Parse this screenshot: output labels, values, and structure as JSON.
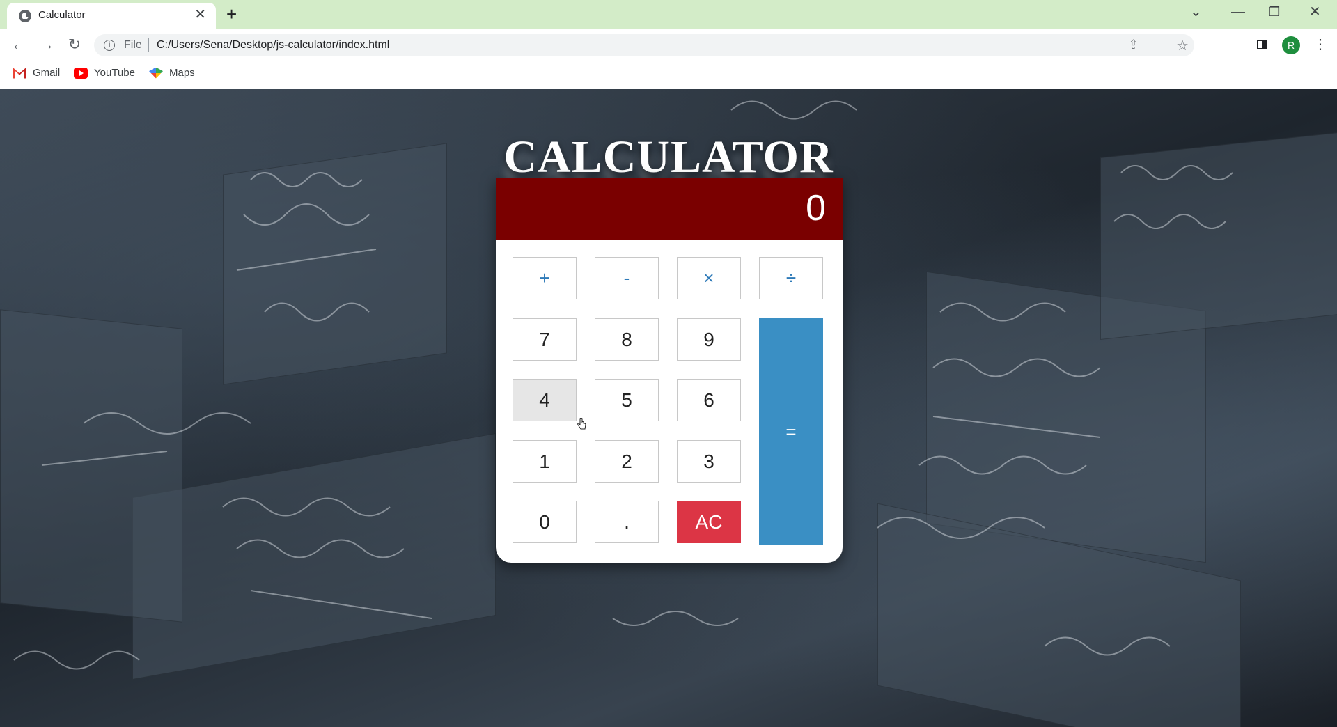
{
  "browser": {
    "tab_title": "Calculator",
    "tab_close": "✕",
    "new_tab": "+",
    "url_scheme": "File",
    "url": "C:/Users/Sena/Desktop/js-calculator/index.html",
    "avatar_initial": "R",
    "bookmarks": [
      "Gmail",
      "YouTube",
      "Maps"
    ]
  },
  "page": {
    "title": "CALCULATOR"
  },
  "calculator": {
    "display": "0",
    "operators": [
      "+",
      "-",
      "×",
      "÷"
    ],
    "rows": [
      [
        "7",
        "8",
        "9"
      ],
      [
        "4",
        "5",
        "6"
      ],
      [
        "1",
        "2",
        "3"
      ],
      [
        "0",
        ".",
        "AC"
      ]
    ],
    "equals": "=",
    "hovered_key": "4"
  },
  "colors": {
    "display_bg": "#7a0000",
    "operator_text": "#2e7ab8",
    "clear_button": "#dc3545",
    "equals_button": "#3a8fc4"
  }
}
